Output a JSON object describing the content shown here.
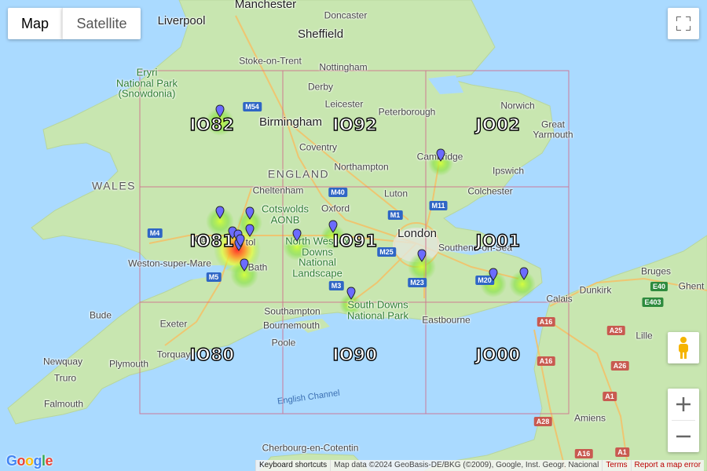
{
  "map_type_control": {
    "map_label": "Map",
    "satellite_label": "Satellite",
    "selected": "Map"
  },
  "places": {
    "manchester": "Manchester",
    "doncaster": "Doncaster",
    "liverpool": "Liverpool",
    "sheffield": "Sheffield",
    "stoke": "Stoke-on-Trent",
    "nottingham": "Nottingham",
    "derby": "Derby",
    "leicester": "Leicester",
    "peterborough": "Peterborough",
    "norwich": "Norwich",
    "great_yarmouth": "Great\nYarmouth",
    "birmingham": "Birmingham",
    "coventry": "Coventry",
    "england": "ENGLAND",
    "northampton": "Northampton",
    "cambridge": "Cambridge",
    "ipswich": "Ipswich",
    "wales": "WALES",
    "cheltenham": "Cheltenham",
    "luton": "Luton",
    "colchester": "Colchester",
    "oxford": "Oxford",
    "london": "London",
    "southend": "Southend-on-Sea",
    "weston": "Weston-super-Mare",
    "bath": "Bath",
    "cardiff": "Ca",
    "bristol": "tol",
    "north_wessex": "North Wessex\nDowns\nNational\nLandscape",
    "cotswolds": "Cotswolds\nAONB",
    "eryri": "Eryri\nNational Park\n(Snowdonia)",
    "south_downs": "South Downs\nNational Park",
    "southampton": "Southampton",
    "bournemouth": "Bournemouth",
    "poole": "Poole",
    "eastbourne": "Eastbourne",
    "exeter": "Exeter",
    "torquay": "Torquay",
    "plymouth": "Plymouth",
    "newquay": "Newquay",
    "truro": "Truro",
    "falmouth": "Falmouth",
    "bude": "Bude",
    "english_channel": "English Channel",
    "calais": "Calais",
    "dunkirk": "Dunkirk",
    "bruges": "Bruges",
    "ghent": "Ghent",
    "lille": "Lille",
    "amiens": "Amiens",
    "cherbourg": "Cherbourg-en-Cotentin"
  },
  "roads": [
    "M54",
    "M40",
    "M1",
    "M11",
    "M4",
    "M5",
    "M3",
    "M25",
    "M23",
    "M20",
    "E40",
    "E403",
    "A25",
    "A26",
    "A16",
    "A1",
    "A28",
    "A16",
    "A16",
    "A1"
  ],
  "grid_squares": [
    "IO82",
    "IO92",
    "JO02",
    "IO81",
    "IO91",
    "JO01",
    "IO80",
    "IO90",
    "JO00"
  ],
  "markers_count": 16,
  "footer": {
    "shortcuts": "Keyboard shortcuts",
    "attribution": "Map data ©2024 GeoBasis-DE/BKG (©2009), Google, Inst. Geogr. Nacional",
    "terms": "Terms",
    "report": "Report a map error"
  },
  "logo": "Google",
  "colors": {
    "water": "#aadaff",
    "land": "#c8e6b0",
    "grid": "#d06a8a",
    "marker": "#6b6bff"
  }
}
